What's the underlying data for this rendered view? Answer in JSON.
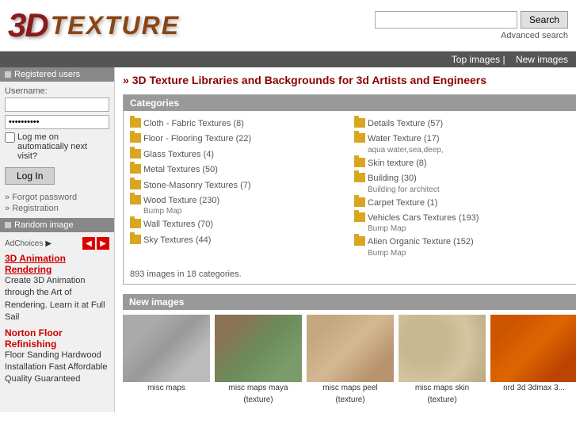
{
  "header": {
    "logo_3d": "3D",
    "logo_texture": "TEXTURE",
    "search_placeholder": "",
    "search_button": "Search",
    "advanced_search": "Advanced search"
  },
  "top_nav": {
    "top_images": "Top images",
    "separator": "|",
    "new_images": "New images"
  },
  "sidebar": {
    "registered_users_label": "Registered users",
    "username_label": "Username:",
    "password_value": "••••••••••",
    "autologin_text": "Log me on automatically next visit?",
    "login_button": "Log In",
    "forgot_password": "Forgot password",
    "registration": "Registration",
    "random_image_label": "Random image",
    "ad_choices": "AdChoices",
    "ad_title1": "3D Animation",
    "ad_title2": "Rendering",
    "ad_body": "Create 3D Animation through the Art of Rendering. Learn it at Full Sail",
    "ad_link_label": "Norton Floor Refinishing",
    "ad_link_body": "Floor Sanding Hardwood Installation Fast Affordable Quality Guaranteed"
  },
  "content": {
    "page_title": "3D Texture Libraries and Backgrounds for 3d Artists and Engineers",
    "categories_header": "Categories",
    "categories": [
      {
        "name": "Cloth - Fabric Textures",
        "count": "(8)",
        "sub": ""
      },
      {
        "name": "Floor - Flooring Texture",
        "count": "(22)",
        "sub": ""
      },
      {
        "name": "Glass Textures",
        "count": "(4)",
        "sub": ""
      },
      {
        "name": "Metal Textures",
        "count": "(50)",
        "sub": ""
      },
      {
        "name": "Stone-Masonry Textures",
        "count": "(7)",
        "sub": ""
      },
      {
        "name": "Wood Texture",
        "count": "(230)",
        "sub": "Bump Map"
      },
      {
        "name": "Wall Textures",
        "count": "(70)",
        "sub": ""
      },
      {
        "name": "Sky Textures",
        "count": "(44)",
        "sub": ""
      }
    ],
    "categories_right": [
      {
        "name": "Details Texture",
        "count": "(57)",
        "sub": ""
      },
      {
        "name": "Water Texture",
        "count": "(17)",
        "sub": "aqua water,sea,deep,"
      },
      {
        "name": "Skin texture",
        "count": "(8)",
        "sub": ""
      },
      {
        "name": "Building",
        "count": "(30)",
        "sub": "Building for architect"
      },
      {
        "name": "Carpet Texture",
        "count": "(1)",
        "sub": ""
      },
      {
        "name": "Vehicles Cars Textures",
        "count": "(193)",
        "sub": "Bump Map"
      },
      {
        "name": "Alien Organic Texture",
        "count": "(152)",
        "sub": "Bump Map"
      }
    ],
    "categories_summary": "893 images in 18 categories.",
    "new_images_header": "New images",
    "thumbnails": [
      {
        "label": "misc maps",
        "sub": "",
        "style": "thumb-gray"
      },
      {
        "label": "misc maps maya",
        "sub": "(texture)",
        "style": "thumb-green"
      },
      {
        "label": "misc maps peel",
        "sub": "(texture)",
        "style": "thumb-tan"
      },
      {
        "label": "misc maps skin",
        "sub": "(texture)",
        "style": "thumb-spot"
      },
      {
        "label": "nrd 3d 3dmax 3...",
        "sub": "",
        "style": "thumb-orange"
      }
    ]
  },
  "footer": {
    "text": "Installation Fast"
  }
}
